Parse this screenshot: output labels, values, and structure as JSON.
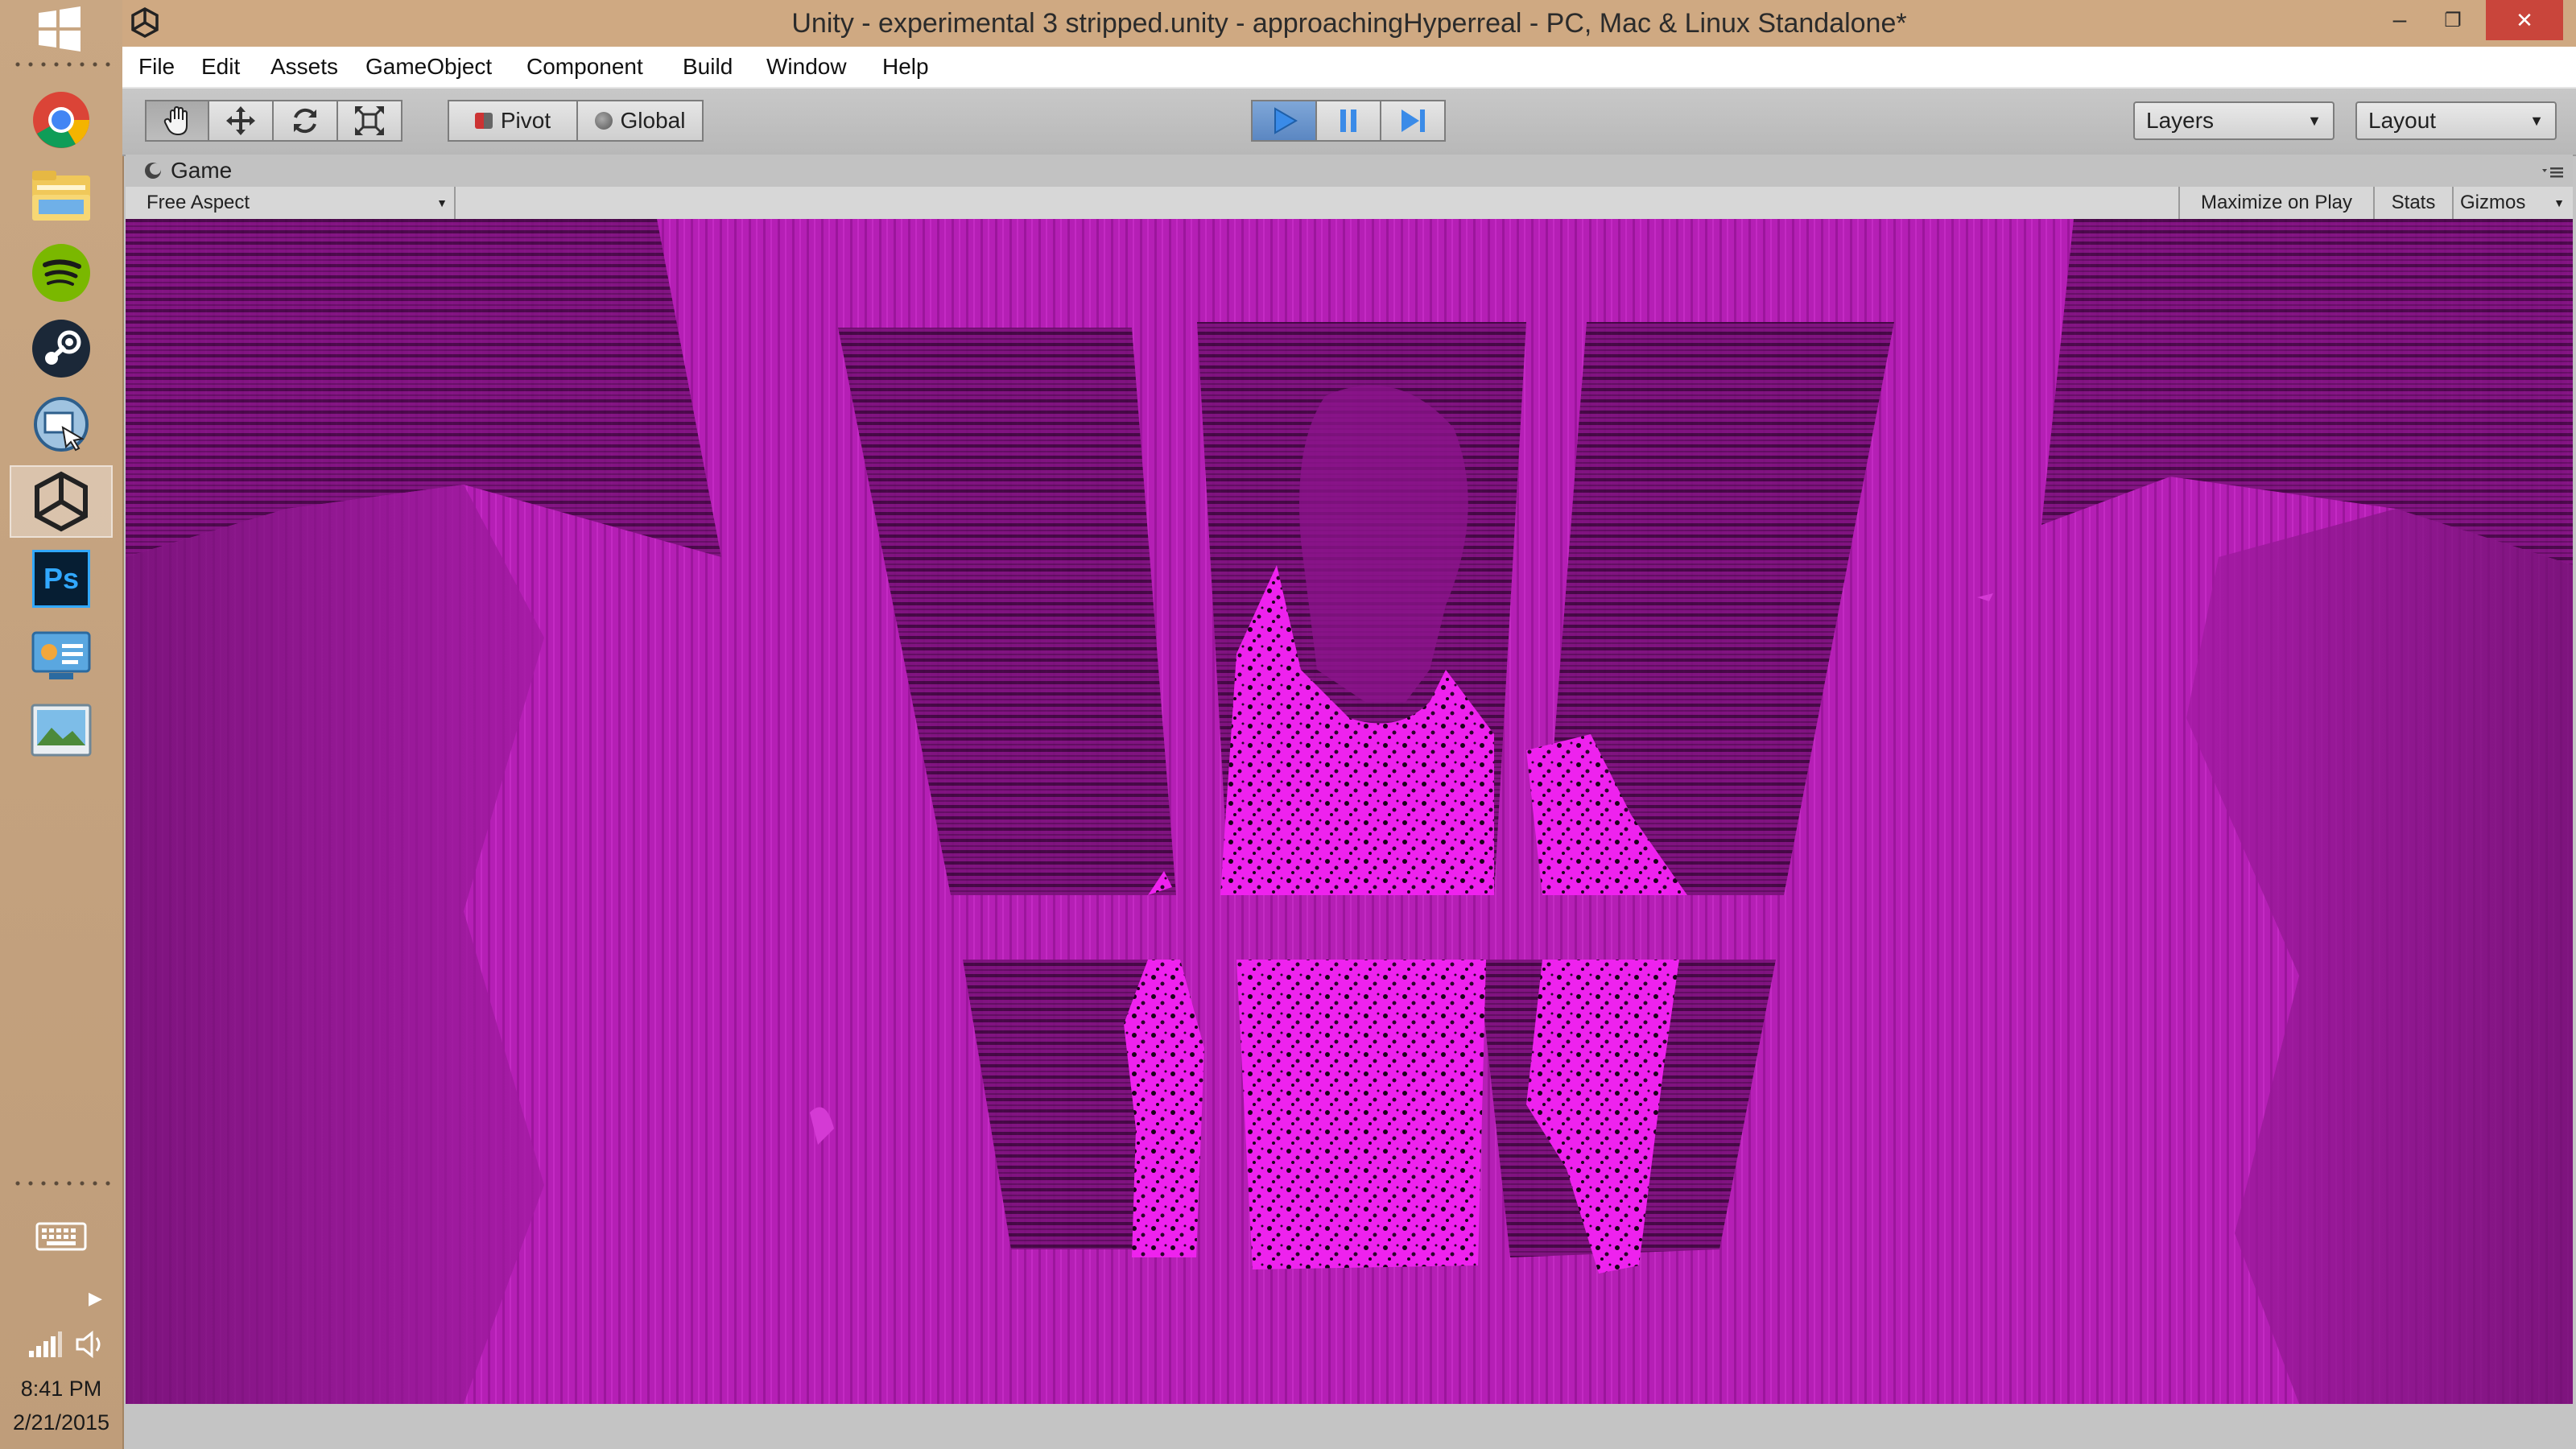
{
  "window": {
    "title": "Unity - experimental 3 stripped.unity - approachingHyperreal - PC, Mac & Linux Standalone*",
    "controls": {
      "minimize": "–",
      "restore": "❐",
      "close": "✕"
    }
  },
  "menu": [
    "File",
    "Edit",
    "Assets",
    "GameObject",
    "Component",
    "Build",
    "Window",
    "Help"
  ],
  "toolbar": {
    "pivot_label": "Pivot",
    "global_label": "Global",
    "layers_label": "Layers",
    "layout_label": "Layout"
  },
  "game_view": {
    "tab_label": "Game",
    "aspect_label": "Free Aspect",
    "maximize_label": "Maximize on Play",
    "stats_label": "Stats",
    "gizmos_label": "Gizmos"
  },
  "taskbar": {
    "photoshop_label": "Ps",
    "time": "8:41 PM",
    "date": "2/21/2015"
  },
  "colors": {
    "accent_play": "#3a8be8",
    "viewport_magenta": "#b01cb0",
    "title_bar": "#cfa982",
    "close_button": "#c9453b"
  },
  "icons": [
    "windows-start-icon",
    "chrome-icon",
    "file-explorer-icon",
    "spotify-icon",
    "steam-icon",
    "remote-desktop-icon",
    "unity-icon",
    "photoshop-icon",
    "control-panel-icon",
    "photo-viewer-icon",
    "keyboard-icon",
    "signal-icon",
    "volume-icon",
    "hand-tool-icon",
    "move-tool-icon",
    "rotate-tool-icon",
    "scale-tool-icon",
    "play-icon",
    "pause-icon",
    "step-icon"
  ]
}
